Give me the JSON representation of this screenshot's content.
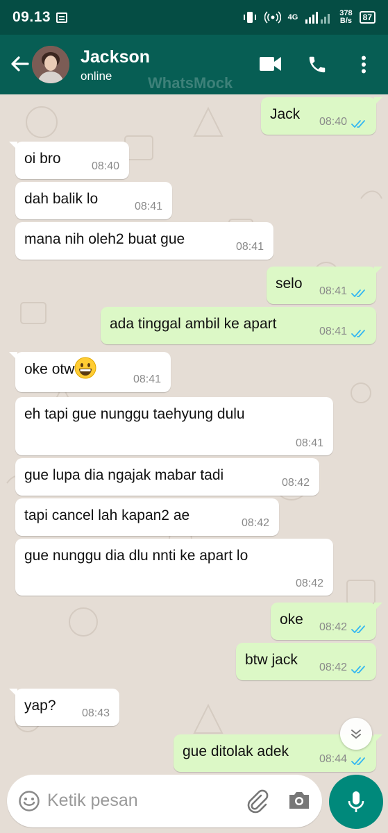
{
  "status_bar": {
    "time": "09.13",
    "network": "4G",
    "speed_value": "378",
    "speed_unit": "B/s",
    "battery": "87"
  },
  "header": {
    "contact_name": "Jackson",
    "contact_status": "online",
    "watermark": "WhatsMock"
  },
  "messages": [
    {
      "dir": "out",
      "text": "Jack",
      "time": "08:40",
      "read": true
    },
    {
      "dir": "in",
      "text": "oi bro",
      "time": "08:40"
    },
    {
      "dir": "in",
      "text": "dah balik lo",
      "time": "08:41"
    },
    {
      "dir": "in",
      "text": "mana nih oleh2 buat gue",
      "time": "08:41"
    },
    {
      "dir": "out",
      "text": "selo",
      "time": "08:41",
      "read": true
    },
    {
      "dir": "out",
      "text": "ada tinggal ambil ke apart",
      "time": "08:41",
      "read": true
    },
    {
      "dir": "in",
      "text": "oke otw",
      "emoji": "grinning-face",
      "time": "08:41"
    },
    {
      "dir": "in",
      "text": "eh tapi gue nunggu taehyung dulu",
      "time": "08:41"
    },
    {
      "dir": "in",
      "text": "gue lupa dia ngajak mabar tadi",
      "time": "08:42"
    },
    {
      "dir": "in",
      "text": "tapi cancel lah kapan2 ae",
      "time": "08:42"
    },
    {
      "dir": "in",
      "text": "gue nunggu dia dlu nnti ke apart lo",
      "time": "08:42"
    },
    {
      "dir": "out",
      "text": "oke",
      "time": "08:42",
      "read": true
    },
    {
      "dir": "out",
      "text": "btw jack",
      "time": "08:42",
      "read": true
    },
    {
      "dir": "in",
      "text": "yap?",
      "time": "08:43"
    },
    {
      "dir": "out",
      "text": "gue ditolak adek",
      "time": "08:44",
      "read": true
    }
  ],
  "input": {
    "placeholder": "Ketik pesan"
  },
  "colors": {
    "header": "#075e54",
    "status_bar": "#054d44",
    "chat_bg": "#e5ddd5",
    "outgoing_bubble": "#dcf8c6",
    "incoming_bubble": "#ffffff",
    "read_ticks": "#34b7f1",
    "mic_button": "#00897b"
  },
  "icons": [
    "back-arrow-icon",
    "video-call-icon",
    "phone-icon",
    "more-vert-icon",
    "emoji-icon",
    "attach-icon",
    "camera-icon",
    "mic-icon",
    "chevron-down-icon",
    "double-check-icon"
  ]
}
